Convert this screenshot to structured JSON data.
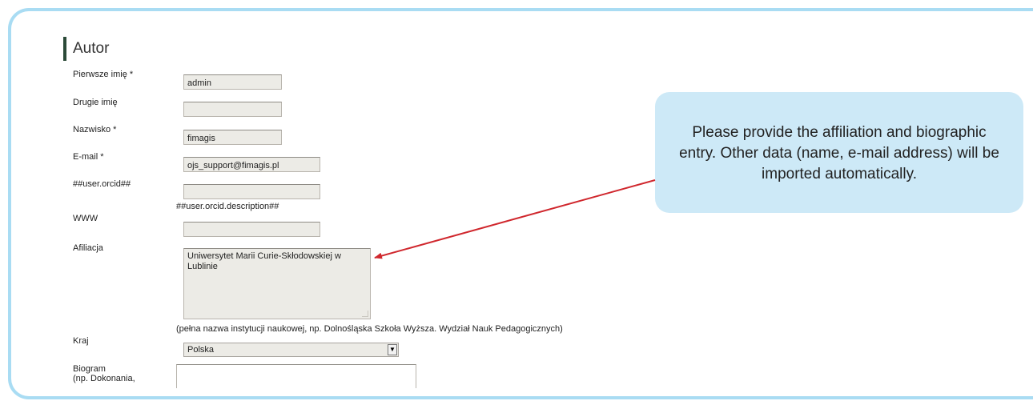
{
  "form": {
    "heading": "Autor",
    "labels": {
      "first_name": "Pierwsze imię *",
      "middle_name": "Drugie imię",
      "last_name": "Nazwisko *",
      "email": "E-mail *",
      "orcid": "##user.orcid##",
      "www": "WWW",
      "affiliation": "Afiliacja",
      "country": "Kraj",
      "biography_line1": "Biogram",
      "biography_line2": "(np. Dokonania,"
    },
    "values": {
      "first_name": "admin",
      "middle_name": "",
      "last_name": "fimagis",
      "email": "ojs_support@fimagis.pl",
      "orcid": "",
      "www": "",
      "affiliation": "Uniwersytet Marii Curie-Skłodowskiej w Lublinie",
      "country": "Polska",
      "biography": ""
    },
    "orcid_description": "##user.orcid.description##",
    "affiliation_hint": "(pełna nazwa instytucji naukowej, np. Dolnośląska Szkoła Wyższa. Wydział Nauk Pedagogicznych)"
  },
  "callout": {
    "text": "Please provide the affiliation and biographic entry. Other data (name, e-mail address) will be imported automatically."
  },
  "colors": {
    "frame_border": "#a9dcf3",
    "callout_bg": "#cde9f7",
    "arrow": "#d0282e",
    "field_bg": "#ecebe6"
  },
  "icons": {
    "select_arrow": "dropdown-arrow-icon"
  }
}
